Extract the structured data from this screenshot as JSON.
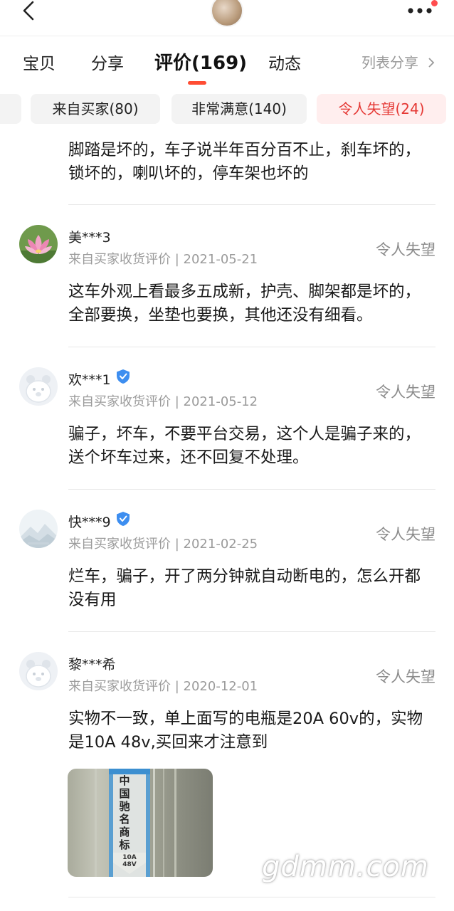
{
  "header": {
    "back_icon": "chevron-left-icon",
    "more_icon": "more-dots-icon",
    "notice_color": "#ff4d4f"
  },
  "tabs": [
    {
      "label": "宝贝"
    },
    {
      "label": "分享"
    },
    {
      "label": "评价(169)",
      "active": true
    },
    {
      "label": "动态"
    }
  ],
  "list_share": "列表分享",
  "filters": [
    {
      "label": "来自买家(80)"
    },
    {
      "label": "非常满意(140)"
    },
    {
      "label": "令人失望(24)",
      "selected": true
    }
  ],
  "accent_color": "#e53935",
  "reviews": [
    {
      "text": "脚踏是坏的，车子说半年百分百不止，刹车坏的，锁坏的，喇叭坏的，停车架也坏的"
    },
    {
      "name": "美***3",
      "avatar": "lotus-avatar",
      "verified": false,
      "source": "来自买家收货评价",
      "date": "2021-05-21",
      "rating": "令人失望",
      "text": "这车外观上看最多五成新，护壳、脚架都是坏的，全部要换，坐垫也要换，其他还没有细看。"
    },
    {
      "name": "欢***1",
      "avatar": "default-bear-avatar",
      "verified": true,
      "source": "来自买家收货评价",
      "date": "2021-05-12",
      "rating": "令人失望",
      "text": "骗子，坏车，不要平台交易，这个人是骗子来的，送个坏车过来，还不回复不处理。"
    },
    {
      "name": "快***9",
      "avatar": "mountain-avatar",
      "verified": true,
      "source": "来自买家收货评价",
      "date": "2021-02-25",
      "rating": "令人失望",
      "text": "烂车，骗子，开了两分钟就自动断电的，怎么开都没有用"
    },
    {
      "name": "黎***希",
      "avatar": "default-bear-avatar",
      "verified": false,
      "source": "来自买家收货评价",
      "date": "2020-12-01",
      "rating": "令人失望",
      "text": "实物不一致，单上面写的电瓶是20A 60v的，实物是10A 48v,买回来才注意到",
      "photo_label": "中国驰名商标",
      "photo_spec": "10A 48V"
    }
  ],
  "meta_separator": " | ",
  "watermark": "gdmm.com"
}
